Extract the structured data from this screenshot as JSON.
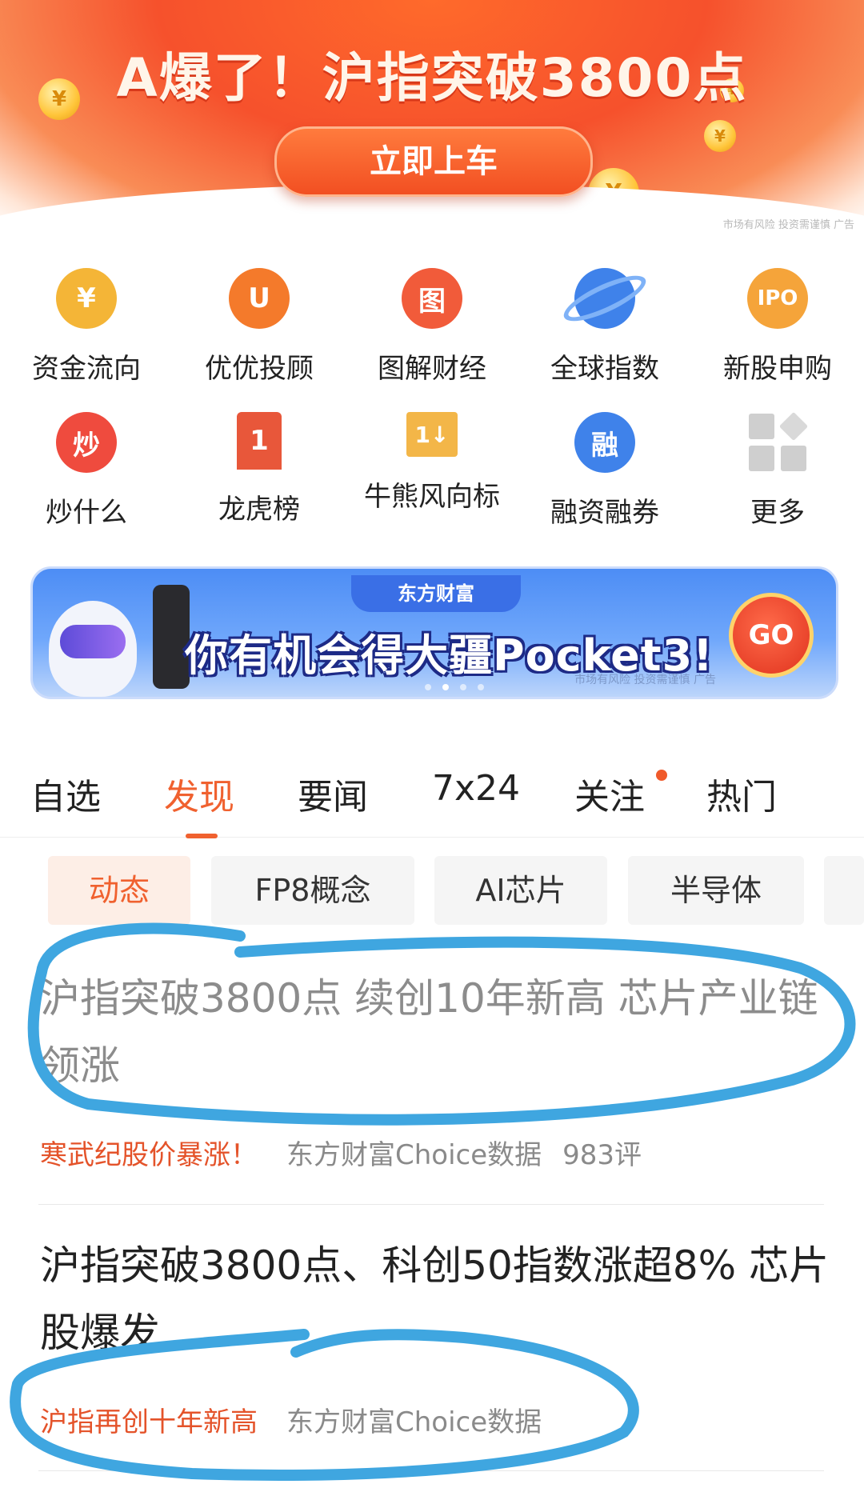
{
  "top_banner": {
    "headline": "A爆了！沪指突破3800点",
    "cta": "立即上车",
    "disclaimer": "市场有风险 投资需谨慎 广告"
  },
  "grid": [
    {
      "label": "资金流向",
      "icon": "yuan-coin-icon",
      "glyph": "¥",
      "color": "#f4b537"
    },
    {
      "label": "优优投顾",
      "icon": "uu-advisor-icon",
      "glyph": "U",
      "color": "#f47a2b"
    },
    {
      "label": "图解财经",
      "icon": "chart-illustration-icon",
      "glyph": "图",
      "color": "#f15b3a"
    },
    {
      "label": "全球指数",
      "icon": "planet-icon",
      "glyph": "",
      "color": "#3f82ea"
    },
    {
      "label": "新股申购",
      "icon": "ipo-icon",
      "glyph": "IPO",
      "color": "#f5a43a"
    },
    {
      "label": "炒什么",
      "icon": "flame-icon",
      "glyph": "炒",
      "color": "#ef4b3e"
    },
    {
      "label": "龙虎榜",
      "icon": "podium-icon",
      "glyph": "1",
      "color": "#e8573a"
    },
    {
      "label": "牛熊风向标",
      "icon": "flag-icon",
      "glyph": "1↓",
      "color": "#f3b648"
    },
    {
      "label": "融资融券",
      "icon": "margin-trading-icon",
      "glyph": "融",
      "color": "#3f82ea"
    },
    {
      "label": "更多",
      "icon": "grid-more-icon",
      "glyph": "",
      "color": "#d2d2d2"
    }
  ],
  "promo": {
    "brand": "东方财富",
    "text": "你有机会得大疆Pocket3!",
    "go": "GO",
    "disclaimer": "市场有风险 投资需谨慎 广告"
  },
  "tabs": [
    "自选",
    "发现",
    "要闻",
    "7x24",
    "关注",
    "热门"
  ],
  "active_tab": "发现",
  "chips": [
    "动态",
    "FP8概念",
    "AI芯片",
    "半导体"
  ],
  "feed": [
    {
      "title": "沪指突破3800点 续创10年新高 芯片产业链领涨",
      "tag": "寒武纪股价暴涨！",
      "source": "东方财富Choice数据",
      "comments": "983评"
    },
    {
      "title": "沪指突破3800点、科创50指数涨超8% 芯片股爆发",
      "tag": "沪指再创十年新高",
      "source": "东方财富Choice数据",
      "comments": ""
    }
  ],
  "colors": {
    "accent": "#f0612f",
    "annotation": "#3fa6e0"
  }
}
